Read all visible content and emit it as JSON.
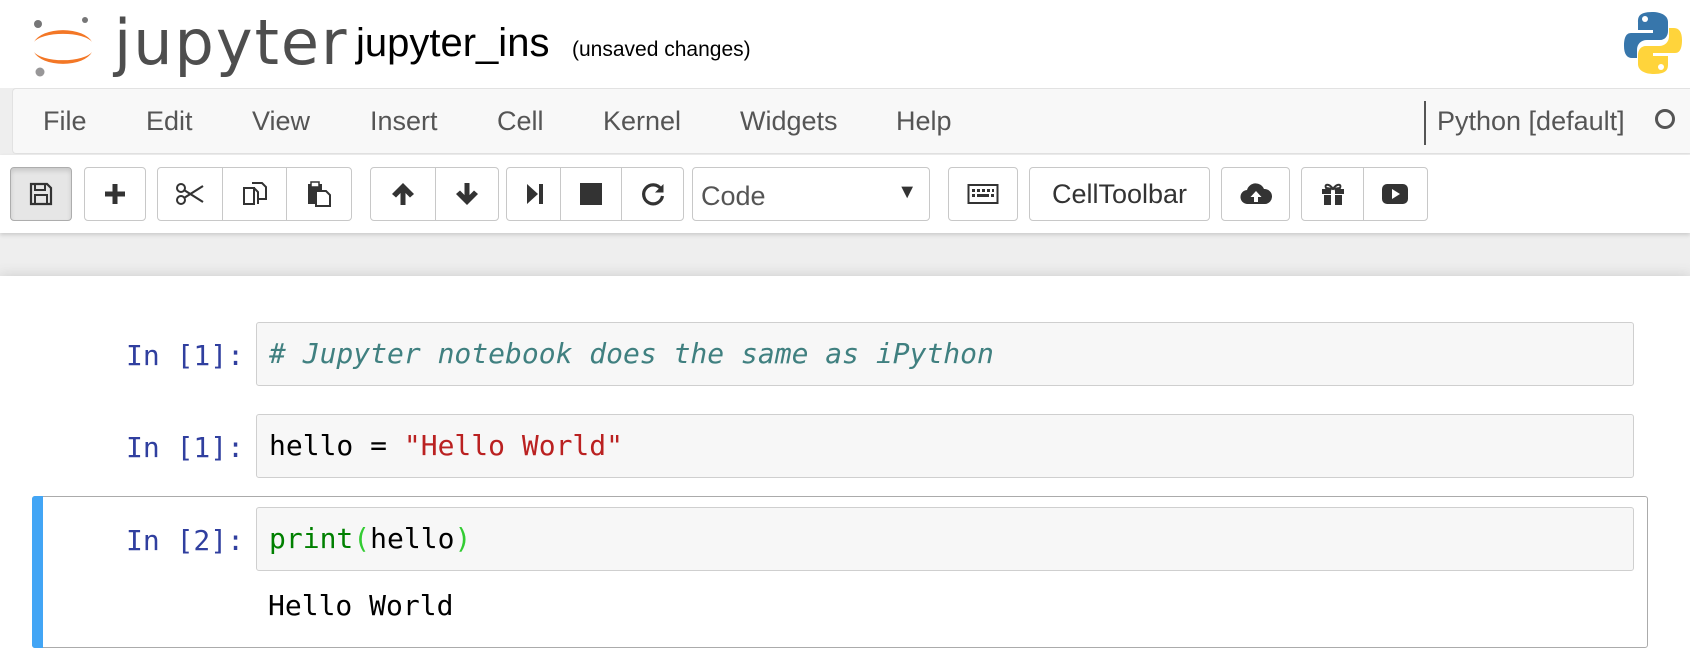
{
  "header": {
    "logo_text": "jupyter",
    "notebook_name": "jupyter_ins",
    "save_status": "(unsaved changes)",
    "logo_icon": "jupyter-logo-icon",
    "kernel_logo_icon": "python-logo-icon"
  },
  "menubar": {
    "items": [
      "File",
      "Edit",
      "View",
      "Insert",
      "Cell",
      "Kernel",
      "Widgets",
      "Help"
    ],
    "kernel_name": "Python [default]",
    "kernel_status_icon": "kernel-idle-circle-icon"
  },
  "toolbar": {
    "icons": [
      "save-icon",
      "plus-icon",
      "cut-icon",
      "copy-icon",
      "paste-icon",
      "arrow-up-icon",
      "arrow-down-icon",
      "step-forward-icon",
      "stop-icon",
      "refresh-icon",
      "keyboard-icon",
      "cloud-upload-icon",
      "gift-icon",
      "youtube-play-icon"
    ],
    "cell_type": "Code",
    "cell_type_arrow": "▼",
    "celltoolbar_label": "CellToolbar"
  },
  "cells": [
    {
      "prompt": "In [1]:",
      "code_comment": "# Jupyter notebook does the same as iPython"
    },
    {
      "prompt": "In [1]:",
      "code_var": "hello = ",
      "code_string": "\"Hello World\""
    },
    {
      "prompt": "In [2]:",
      "code_builtin": "print",
      "code_open": "(",
      "code_arg": "hello",
      "code_close": ")",
      "output": "Hello World"
    }
  ],
  "colors": {
    "prompt": "#303f9f",
    "selected_cell_bar": "#42a5f5",
    "logo_orange": "#f37726",
    "python_blue": "#3776ab",
    "python_yellow": "#ffd43b"
  }
}
